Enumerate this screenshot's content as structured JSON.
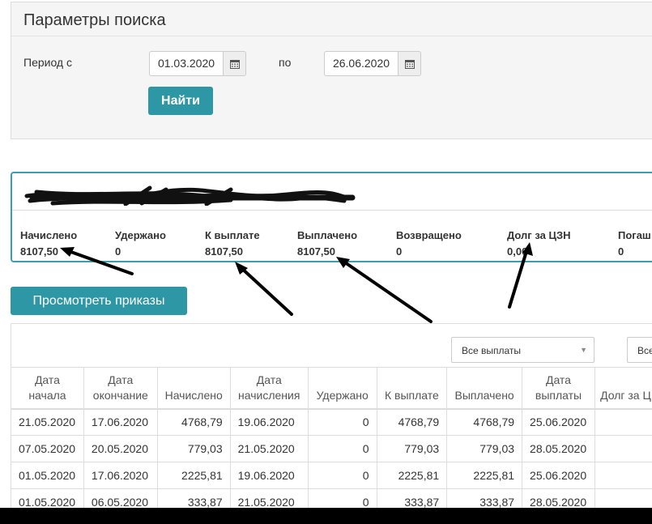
{
  "search": {
    "title": "Параметры поиска",
    "period_from_label": "Период с",
    "date_from": "01.03.2020",
    "to_label": "по",
    "date_to": "26.06.2020",
    "find_button": "Найти"
  },
  "summary": {
    "items": [
      {
        "label": "Начислено",
        "value": "8107,50"
      },
      {
        "label": "Удержано",
        "value": "0"
      },
      {
        "label": "К выплате",
        "value": "8107,50"
      },
      {
        "label": "Выплачено",
        "value": "8107,50"
      },
      {
        "label": "Возвращено",
        "value": "0"
      },
      {
        "label": "Долг за ЦЗН",
        "value": "0,00"
      },
      {
        "label": "Погаш",
        "value": "0"
      }
    ]
  },
  "orders_button": "Просмотреть приказы",
  "filters": {
    "payments_select": "Все выплаты",
    "second_select": "Все"
  },
  "table": {
    "headers": [
      "Дата начала",
      "Дата окончание",
      "Начислено",
      "Дата начисления",
      "Удержано",
      "К выплате",
      "Выплачено",
      "Дата выплаты",
      "Долг за Ц"
    ],
    "rows": [
      [
        "21.05.2020",
        "17.06.2020",
        "4768,79",
        "19.06.2020",
        "0",
        "4768,79",
        "4768,79",
        "25.06.2020",
        ""
      ],
      [
        "07.05.2020",
        "20.05.2020",
        "779,03",
        "21.05.2020",
        "0",
        "779,03",
        "779,03",
        "28.05.2020",
        ""
      ],
      [
        "01.05.2020",
        "17.06.2020",
        "2225,81",
        "19.06.2020",
        "0",
        "2225,81",
        "2225,81",
        "25.06.2020",
        ""
      ],
      [
        "01.05.2020",
        "06.05.2020",
        "333,87",
        "21.05.2020",
        "0",
        "333,87",
        "333,87",
        "28.05.2020",
        ""
      ]
    ]
  },
  "colors": {
    "accent": "#2e97a6",
    "panel_border": "#3a9eab",
    "panel_bg": "#f5f5f5"
  }
}
